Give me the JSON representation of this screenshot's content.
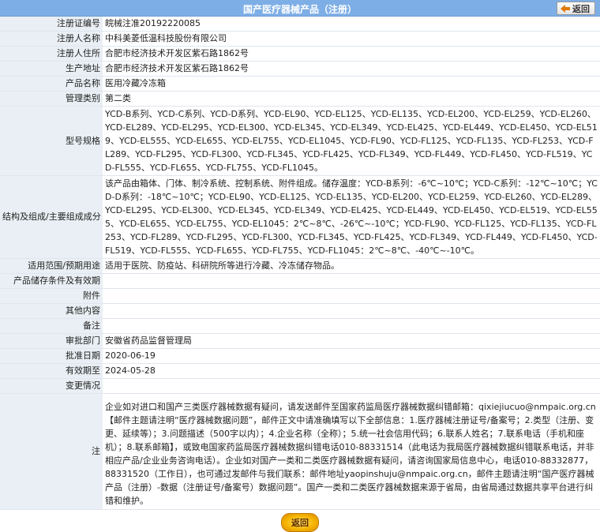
{
  "header": {
    "title": "国产医疗器械产品（注册）",
    "back_label": "返回"
  },
  "rows": [
    {
      "label": "注册证编号",
      "value": "皖械注准20192220085"
    },
    {
      "label": "注册人名称",
      "value": "中科美菱低温科技股份有限公司"
    },
    {
      "label": "注册人住所",
      "value": "合肥市经济技术开发区紫石路1862号"
    },
    {
      "label": "生产地址",
      "value": "合肥市经济技术开发区紫石路1862号"
    },
    {
      "label": "产品名称",
      "value": "医用冷藏冷冻箱"
    },
    {
      "label": "管理类别",
      "value": "第二类"
    },
    {
      "label": "型号规格",
      "value": "YCD-B系列、YCD-C系列、YCD-D系列、YCD-EL90、YCD-EL125、YCD-EL135、YCD-EL200、YCD-EL259、YCD-EL260、YCD-EL289、YCD-EL295、YCD-EL300、YCD-EL345、YCD-EL349、YCD-EL425、YCD-EL449、YCD-EL450、YCD-EL519、YCD-EL555、YCD-EL655、YCD-EL755、YCD-EL1045、YCD-FL90、YCD-FL125、YCD-FL135、YCD-FL253、YCD-FL289、YCD-FL295、YCD-FL300、YCD-FL345、YCD-FL425、YCD-FL349、YCD-FL449、YCD-FL450、YCD-FL519、YCD-FL555、YCD-FL655、YCD-FL755、YCD-FL1045。"
    },
    {
      "label": "结构及组成/主要组成成分",
      "value": "该产品由箱体、门体、制冷系统、控制系统、附件组成。储存温度：YCD-B系列：-6℃~10℃；YCD-C系列：-12℃~10℃；YCD-D系列：-18℃~10℃；YCD-EL90、YCD-EL125、YCD-EL135、YCD-EL200、YCD-EL259、YCD-EL260、YCD-EL289、YCD-EL295、YCD-EL300、YCD-EL345、YCD-EL349、YCD-EL425、YCD-EL449、YCD-EL450、YCD-EL519、YCD-EL555、YCD-EL655、YCD-EL755、YCD-EL1045：2℃~8℃、-26℃~-10℃；YCD-FL90、YCD-FL125、YCD-FL135、YCD-FL253、YCD-FL289、YCD-FL295、YCD-FL300、YCD-FL345、YCD-FL425、YCD-FL349、YCD-FL449、YCD-FL450、YCD-FL519、YCD-FL555、YCD-FL655、YCD-FL755、YCD-FL1045：2℃~8℃、-40℃~-10℃。"
    },
    {
      "label": "适用范围/预期用途",
      "value": "适用于医院、防疫站、科研院所等进行冷藏、冷冻储存物品。"
    },
    {
      "label": "产品储存条件及有效期",
      "value": ""
    },
    {
      "label": "附件",
      "value": ""
    },
    {
      "label": "其他内容",
      "value": ""
    },
    {
      "label": "备注",
      "value": ""
    },
    {
      "label": "审批部门",
      "value": "安徽省药品监督管理局"
    },
    {
      "label": "批准日期",
      "value": "2020-06-19"
    },
    {
      "label": "有效期至",
      "value": "2024-05-28"
    },
    {
      "label": "变更情况",
      "value": ""
    }
  ],
  "note": {
    "label": "注",
    "text": "企业如对进口和国产三类医疗器械数据有疑问，请发送邮件至国家药监局医疗器械数据纠错邮箱：qixiejiucuo@nmpaic.org.cn【邮件主题请注明“医疗器械数据问题”，邮件正文中请准确填写以下全部信息：1.医疗器械注册证号/备案号；2.类型（注册、变更、延续等）；3.问题描述（500字以内）；4.企业名称（全称）；5.统一社会信用代码；6.联系人姓名；7.联系电话（手机和座机）；8.联系邮箱】，或致电国家药监局医疗器械数据纠错电话010-88331514（此电话为我局医疗器械数据纠错联系电话，并非相应产品/企业业务咨询电话）。企业如对国产一类和二类医疗器械数据有疑问，请咨询国家局信息中心，电话010-88332877，88331520（工作日），也可通过发邮件与我们联系：邮件地址yaopinshuju@nmpaic.org.cn，邮件主题请注明“国产医疗器械产品（注册）-数据（注册证号/备案号）数据问题”。国产一类和二类医疗器械数据来源于省局，由省局通过数据共享平台进行纠错和维护。"
  },
  "footer": {
    "back_label": "返回"
  }
}
